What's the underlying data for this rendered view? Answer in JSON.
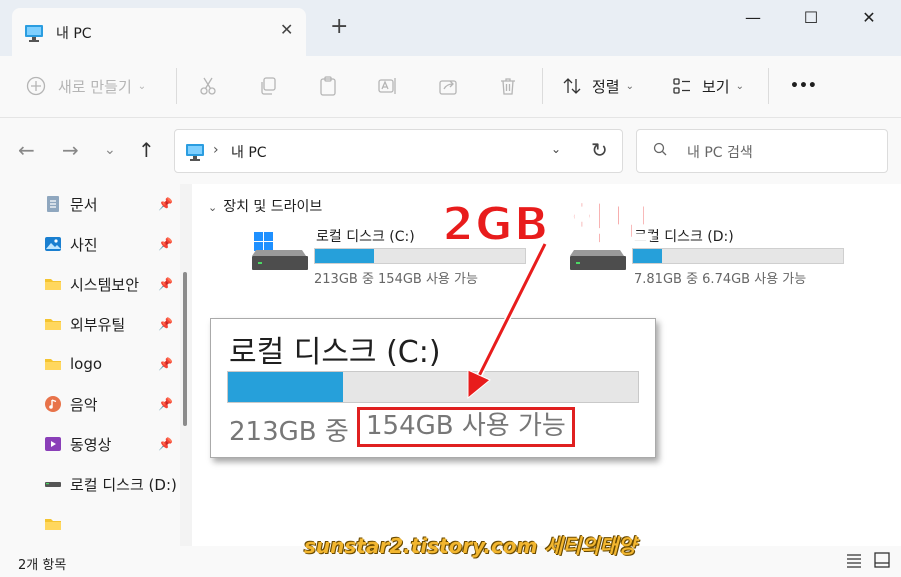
{
  "window": {
    "tab_title": "내 PC",
    "controls": {
      "minimize": "—",
      "maximize": "☐",
      "close": "✕",
      "new_tab": "+",
      "tab_close": "✕"
    }
  },
  "toolbar": {
    "new_label": "새로 만들기",
    "sort_label": "정렬",
    "view_label": "보기",
    "more_label": "•••"
  },
  "address": {
    "path": "내 PC",
    "separator": "›"
  },
  "search": {
    "placeholder": "내 PC 검색"
  },
  "sidebar": {
    "items": [
      {
        "label": "문서",
        "icon": "document-icon",
        "pinned": true
      },
      {
        "label": "사진",
        "icon": "pictures-icon",
        "pinned": true
      },
      {
        "label": "시스템보안",
        "icon": "folder-icon",
        "pinned": true
      },
      {
        "label": "외부유틸",
        "icon": "folder-icon",
        "pinned": true
      },
      {
        "label": "logo",
        "icon": "folder-icon",
        "pinned": true
      },
      {
        "label": "음악",
        "icon": "music-icon",
        "pinned": true
      },
      {
        "label": "동영상",
        "icon": "video-icon",
        "pinned": true
      },
      {
        "label": "로컬 디스크 (D:)",
        "icon": "drive-icon",
        "pinned": false
      },
      {
        "label": "",
        "icon": "folder-icon",
        "pinned": false
      }
    ]
  },
  "main": {
    "group_header": "장치 및 드라이브",
    "drives": [
      {
        "name": "로컬 디스크 (C:)",
        "info": "213GB 중 154GB 사용 가능",
        "used_fraction": 0.28
      },
      {
        "name": "로컬 디스크 (D:)",
        "info": "7.81GB 중 6.74GB 사용 가능",
        "used_fraction": 0.14
      }
    ]
  },
  "zoom_callout": {
    "name": "로컬 디스크 (C:)",
    "total": "213GB 중",
    "free": "154GB 사용 가능",
    "used_fraction": 0.28
  },
  "annotation": {
    "headline": "2GB 확보"
  },
  "watermark": {
    "text": "sunstar2.tistory.com 세티의태양"
  },
  "status": {
    "item_count": "2개 항목"
  },
  "colors": {
    "accent": "#26a0da",
    "highlight": "#e02020",
    "annotation": "#e81c1c"
  }
}
